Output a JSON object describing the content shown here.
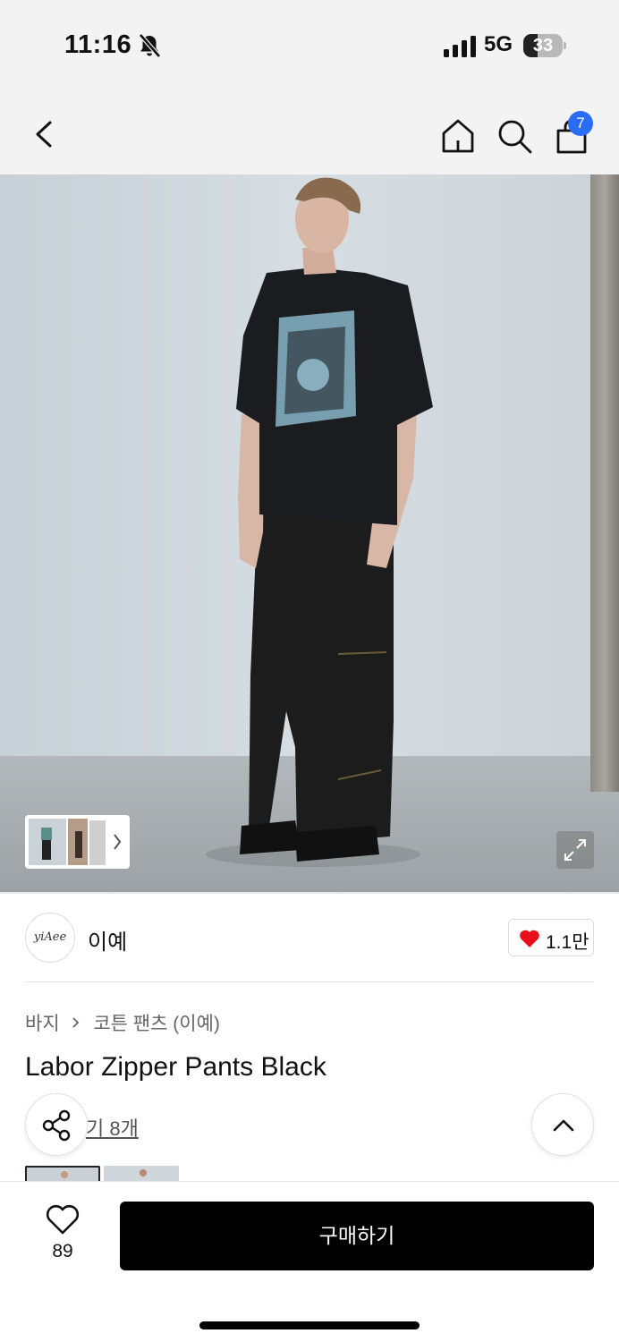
{
  "status_bar": {
    "time": "11:16",
    "network": "5G",
    "battery": "33"
  },
  "nav": {
    "cart_count": "7"
  },
  "brand": {
    "logo_text": "yiAee",
    "name": "이예",
    "like_count": "1.1만"
  },
  "breadcrumb": [
    "바지",
    "코튼 팬츠 (이예)"
  ],
  "product": {
    "title": "Labor Zipper Pants Black",
    "review_link": "기 8개"
  },
  "bottom_bar": {
    "wish_count": "89",
    "buy_label": "구매하기"
  },
  "colors": {
    "accent_badge": "#2a6cf5",
    "heart": "#e8101b",
    "buy_button": "#000000"
  }
}
